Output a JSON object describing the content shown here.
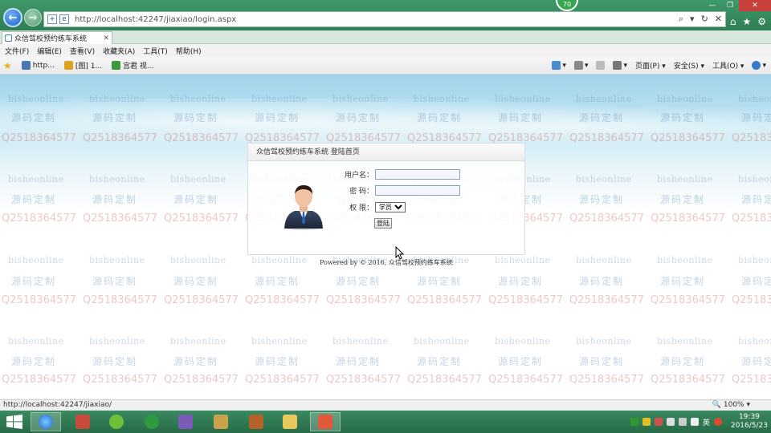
{
  "browser": {
    "address": "http://localhost:42247/jiaxiao/login.aspx",
    "tab_title": "众信驾校预约练车系统",
    "badge": "70",
    "menu": [
      "文件(F)",
      "编辑(E)",
      "查看(V)",
      "收藏夹(A)",
      "工具(T)",
      "帮助(H)"
    ],
    "favorites": [
      {
        "label": "http...",
        "color": "#4a78b5"
      },
      {
        "label": "[图] 1...",
        "color": "#e0a020"
      },
      {
        "label": "宫君 视...",
        "color": "#3b9a3b"
      }
    ],
    "commands": [
      "页面(P) ▾",
      "安全(S) ▾",
      "工具(O) ▾"
    ]
  },
  "watermark": {
    "site": "bisheonline",
    "slogan": "源码定制",
    "qq": "Q2518364577"
  },
  "login": {
    "title": "众信驾校预约练车系统 登陆首页",
    "username_label": "用户名：",
    "password_label": "密  码：",
    "role_label": "权  限：",
    "role_selected": "学员",
    "submit_label": "登陆"
  },
  "footer": {
    "powered": "Powered by © 2016, 众信驾校预约练车系统"
  },
  "status": {
    "url": "http://localhost:42247/jiaxiao/",
    "zoom": "100%"
  },
  "taskbar": {
    "time": "19:39",
    "date": "2016/5/23",
    "ime": "英"
  }
}
